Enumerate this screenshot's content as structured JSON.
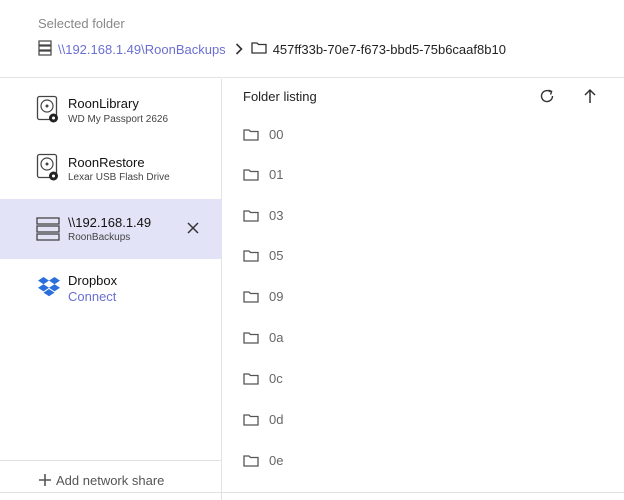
{
  "header": {
    "label": "Selected folder",
    "breadcrumb": {
      "root_icon": "server-icon",
      "path_link": "\\\\192.168.1.49\\RoonBackups",
      "separator_icon": "chevron-right-icon",
      "folder_icon": "folder-icon",
      "current": "457ff33b-70e7-f673-bbd5-75b6caaf8b10"
    }
  },
  "sidebar": {
    "devices": [
      {
        "name": "RoonLibrary",
        "sub": "WD My Passport 2626",
        "icon": "hard-drive-icon"
      },
      {
        "name": "RoonRestore",
        "sub": "Lexar USB Flash Drive",
        "icon": "hard-drive-icon"
      },
      {
        "name": "\\\\192.168.1.49",
        "sub": "RoonBackups",
        "icon": "server-icon",
        "selected": true
      },
      {
        "name": "Dropbox",
        "link": "Connect",
        "icon": "dropbox-icon"
      }
    ],
    "add_share": {
      "icon": "plus-icon",
      "label": "Add network share"
    }
  },
  "main": {
    "title": "Folder listing",
    "refresh_icon": "refresh-icon",
    "up_icon": "arrow-up-icon",
    "folders": [
      "00",
      "01",
      "03",
      "05",
      "09",
      "0a",
      "0c",
      "0d",
      "0e"
    ]
  },
  "colors": {
    "accent": "#6b6fd1",
    "selected_bg": "#e3e3f7",
    "divider": "#e2e2e2",
    "dropbox": "#2a6fdb"
  }
}
